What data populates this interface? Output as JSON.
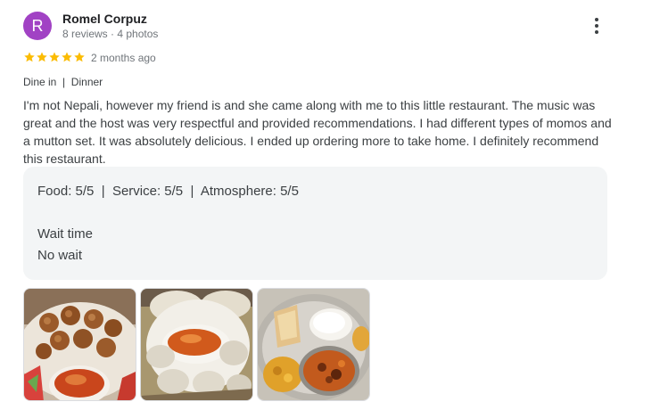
{
  "reviewer": {
    "initial": "R",
    "name": "Romel Corpuz",
    "meta": "8 reviews · 4 photos"
  },
  "review": {
    "rating": 5,
    "date": "2 months ago",
    "dining": "Dine in  |  Dinner",
    "text": "I'm not Nepali, however my friend is and she came along with me to this little restaurant. The music was great and the host was very respectful and provided recommendations. I had different types of momos and a mutton set. It was absolutely delicious. I ended up ordering more to take home. I definitely recommend this restaurant."
  },
  "ratings": {
    "line": "Food: 5/5  |  Service: 5/5  |  Atmosphere: 5/5",
    "wait_label": "Wait time",
    "wait_value": "No wait"
  },
  "icons": {
    "more": "more-vert-icon",
    "star": "star-icon"
  },
  "colors": {
    "avatar": "#a142c4",
    "star": "#fbbc04",
    "box": "#f1f3f4"
  }
}
